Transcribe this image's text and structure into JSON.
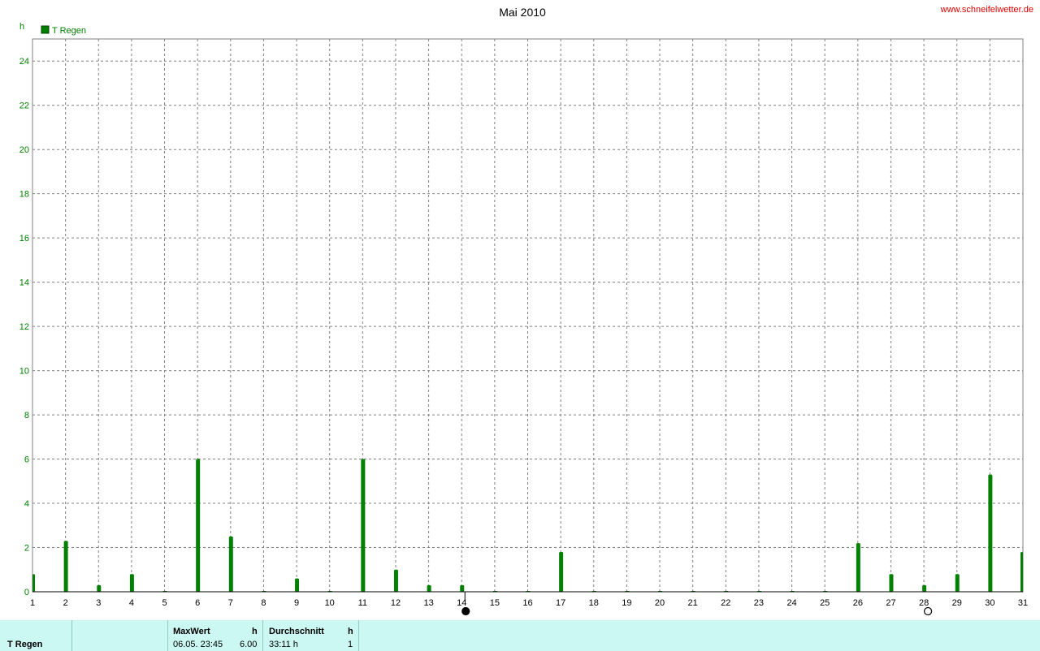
{
  "title": "Mai 2010",
  "site": "www.schneifelwetter.de",
  "y_unit": "h",
  "colors": {
    "series": "#008000",
    "footer_bg": "#ccf8f4",
    "site": "#e00000"
  },
  "chart_data": {
    "type": "bar",
    "title": "Mai 2010",
    "ylabel": "h",
    "ylim": [
      0,
      25
    ],
    "yticks": [
      0,
      2,
      4,
      6,
      8,
      10,
      12,
      14,
      16,
      18,
      20,
      22,
      24
    ],
    "categories": [
      "1",
      "2",
      "3",
      "4",
      "5",
      "6",
      "7",
      "8",
      "9",
      "10",
      "11",
      "12",
      "13",
      "14",
      "15",
      "16",
      "17",
      "18",
      "19",
      "20",
      "21",
      "22",
      "23",
      "24",
      "25",
      "26",
      "27",
      "28",
      "29",
      "30",
      "31"
    ],
    "series": [
      {
        "name": "T Regen",
        "values": [
          0.8,
          2.3,
          0.3,
          0.8,
          0.0,
          6.0,
          2.5,
          0.0,
          0.6,
          0.0,
          6.0,
          1.0,
          0.3,
          0.3,
          0.0,
          0.0,
          1.8,
          0.0,
          0.0,
          0.0,
          0.0,
          0.0,
          0.0,
          0.0,
          0.0,
          2.2,
          0.8,
          0.3,
          0.8,
          5.3,
          1.8
        ]
      }
    ],
    "grid": true,
    "legend": "top-left",
    "moon_phases": [
      {
        "day": "14",
        "phase": "new-moon"
      },
      {
        "day": "28",
        "phase": "full-moon"
      }
    ]
  },
  "footer": {
    "series_label": "T Regen",
    "max_header": "MaxWert",
    "max_unit": "h",
    "max_date": "06.05.  23:45",
    "max_value": "6.00",
    "avg_header": "Durchschnitt",
    "avg_unit": "h",
    "avg_value": "33:11 h",
    "avg_count": "1"
  }
}
